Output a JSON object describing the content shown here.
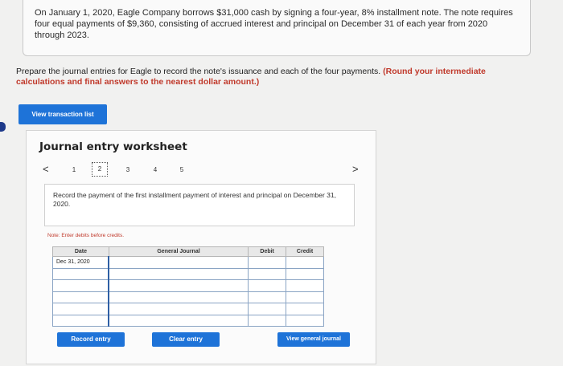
{
  "problem": {
    "text": "On January 1, 2020, Eagle Company borrows $31,000 cash by signing a four-year, 8% installment note. The note requires four equal payments of $9,360, consisting of accrued interest and principal on December 31 of each year from 2020 through 2023."
  },
  "instructions": {
    "text": "Prepare the journal entries for Eagle to record the note's issuance and each of the four payments. ",
    "emphasis": "(Round your intermediate calculations and final answers to the nearest dollar amount.)"
  },
  "buttons": {
    "view_transaction_list": "View transaction list",
    "record_entry": "Record entry",
    "clear_entry": "Clear entry",
    "view_general_journal": "View general journal"
  },
  "worksheet": {
    "title": "Journal entry worksheet",
    "pages": [
      "1",
      "2",
      "3",
      "4",
      "5"
    ],
    "active_page": "2",
    "prev_glyph": "<",
    "next_glyph": ">",
    "record_text": "Record the payment of the first installment payment of interest and principal on December 31, 2020.",
    "note": "Note: Enter debits before credits."
  },
  "journal": {
    "headers": {
      "date": "Date",
      "general_journal": "General Journal",
      "debit": "Debit",
      "credit": "Credit"
    },
    "rows": [
      {
        "date": "Dec 31, 2020",
        "account": "",
        "debit": "",
        "credit": ""
      },
      {
        "date": "",
        "account": "",
        "debit": "",
        "credit": ""
      },
      {
        "date": "",
        "account": "",
        "debit": "",
        "credit": ""
      },
      {
        "date": "",
        "account": "",
        "debit": "",
        "credit": ""
      },
      {
        "date": "",
        "account": "",
        "debit": "",
        "credit": ""
      },
      {
        "date": "",
        "account": "",
        "debit": "",
        "credit": ""
      }
    ]
  },
  "colors": {
    "button_blue": "#1e73d8",
    "note_red": "#c0392b"
  }
}
